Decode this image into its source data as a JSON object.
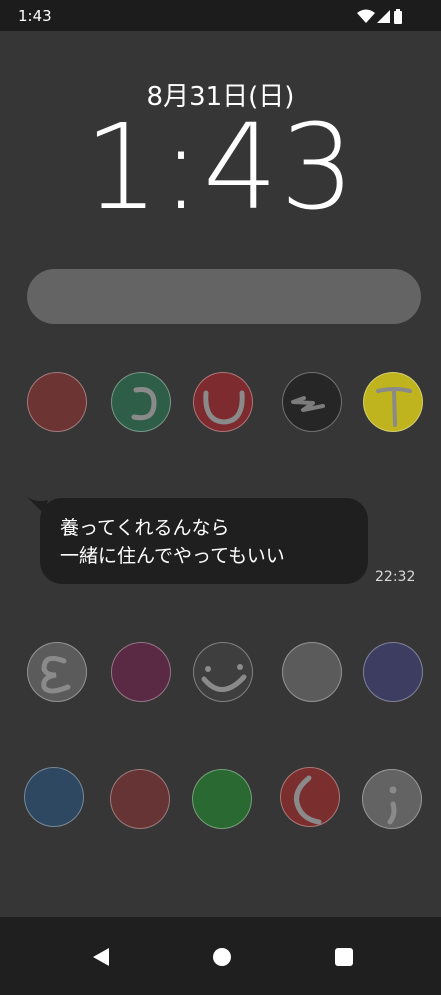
{
  "status_bar": {
    "time": "1:43",
    "icons": [
      "wifi-icon",
      "signal-icon",
      "battery-icon"
    ]
  },
  "lockscreen": {
    "date": "8月31日(日)",
    "clock": "1:43"
  },
  "message": {
    "lines": [
      "養ってくれるんなら",
      "一緒に住んでやってもいい"
    ],
    "time": "22:32"
  },
  "stamp_buttons": {
    "row1": [
      {
        "name": "stamp-button-red",
        "color": "#6d3434",
        "glyph": "none"
      },
      {
        "name": "stamp-button-green-c",
        "color": "#2f5e48",
        "glyph": "c"
      },
      {
        "name": "stamp-button-red-u",
        "color": "#7d2b2e",
        "glyph": "u"
      },
      {
        "name": "stamp-button-black-wave",
        "color": "#262626",
        "glyph": "wave"
      },
      {
        "name": "stamp-button-yellow-t",
        "color": "#bfb41e",
        "glyph": "t"
      }
    ],
    "row2": [
      {
        "name": "stamp-button-gray-epsilon",
        "color": "#5b5b5b",
        "glyph": "epsilon"
      },
      {
        "name": "stamp-button-purple",
        "color": "#5a2a45",
        "glyph": "none"
      },
      {
        "name": "stamp-button-dark-smile",
        "color": "#3e3e3e",
        "glyph": "smile"
      },
      {
        "name": "stamp-button-gray",
        "color": "#5b5b5b",
        "glyph": "none"
      },
      {
        "name": "stamp-button-navy",
        "color": "#3d3d62",
        "glyph": "none"
      }
    ],
    "row3": [
      {
        "name": "stamp-button-blue",
        "color": "#2d4860",
        "glyph": "none"
      },
      {
        "name": "stamp-button-maroon",
        "color": "#663434",
        "glyph": "none"
      },
      {
        "name": "stamp-button-green",
        "color": "#2a6a32",
        "glyph": "none"
      },
      {
        "name": "stamp-button-red-open-c",
        "color": "#7a2e2e",
        "glyph": "openc"
      },
      {
        "name": "stamp-button-gray-semicolon",
        "color": "#636363",
        "glyph": "semicolon"
      }
    ]
  },
  "nav_bar": {
    "buttons": [
      "back-icon",
      "home-icon",
      "recents-icon"
    ]
  }
}
